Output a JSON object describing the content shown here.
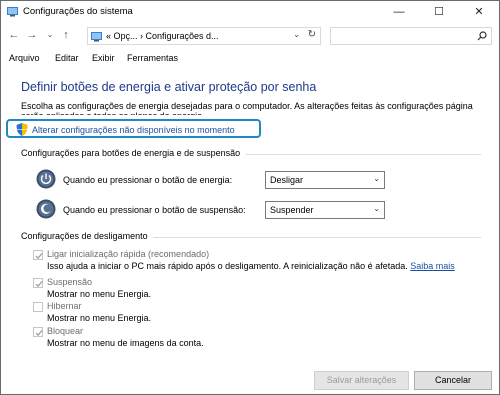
{
  "window": {
    "title": "Configurações do sistema",
    "minimize": "—",
    "maximize": "☐",
    "close": "✕"
  },
  "nav": {
    "address": "«  Opç...  ›  Configurações d...",
    "dropdown": "⌄",
    "refresh": "↻",
    "search_placeholder": ""
  },
  "menu": [
    "Arquivo",
    "Editar",
    "Exibir",
    "Ferramentas"
  ],
  "content": {
    "heading": "Definir botões de energia e ativar proteção por senha",
    "description": "Escolha as configurações de energia desejadas para o computador. As alterações feitas às configurações página serão aplicadas a todos os planos de energia.",
    "change_link": "Alterar configurações não disponíveis no momento"
  },
  "power_buttons": {
    "group_title": "Configurações para botões de energia e de suspensão",
    "rows": [
      {
        "label": "Quando eu pressionar o botão de energia:",
        "value": "Desligar"
      },
      {
        "label": "Quando eu pressionar o botão de suspensão:",
        "value": "Suspender"
      }
    ]
  },
  "shutdown": {
    "group_title": "Configurações de desligamento",
    "options": [
      {
        "label": "Ligar inicialização rápida (recomendado)",
        "desc": "Isso ajuda a iniciar o PC mais rápido após o desligamento. A reinicialização não é afetada.",
        "link": "Saiba mais",
        "checked": true
      },
      {
        "label": "Suspensão",
        "desc": "Mostrar no menu Energia.",
        "checked": true
      },
      {
        "label": "Hibernar",
        "desc": "Mostrar no menu Energia.",
        "checked": false
      },
      {
        "label": "Bloquear",
        "desc": "Mostrar no menu de imagens da conta.",
        "checked": true
      }
    ]
  },
  "footer": {
    "save": "Salvar alterações",
    "cancel": "Cancelar"
  },
  "colors": {
    "heading": "#1e3a8a",
    "link": "#1a4fa0",
    "highlight_border": "#1e88c9"
  }
}
